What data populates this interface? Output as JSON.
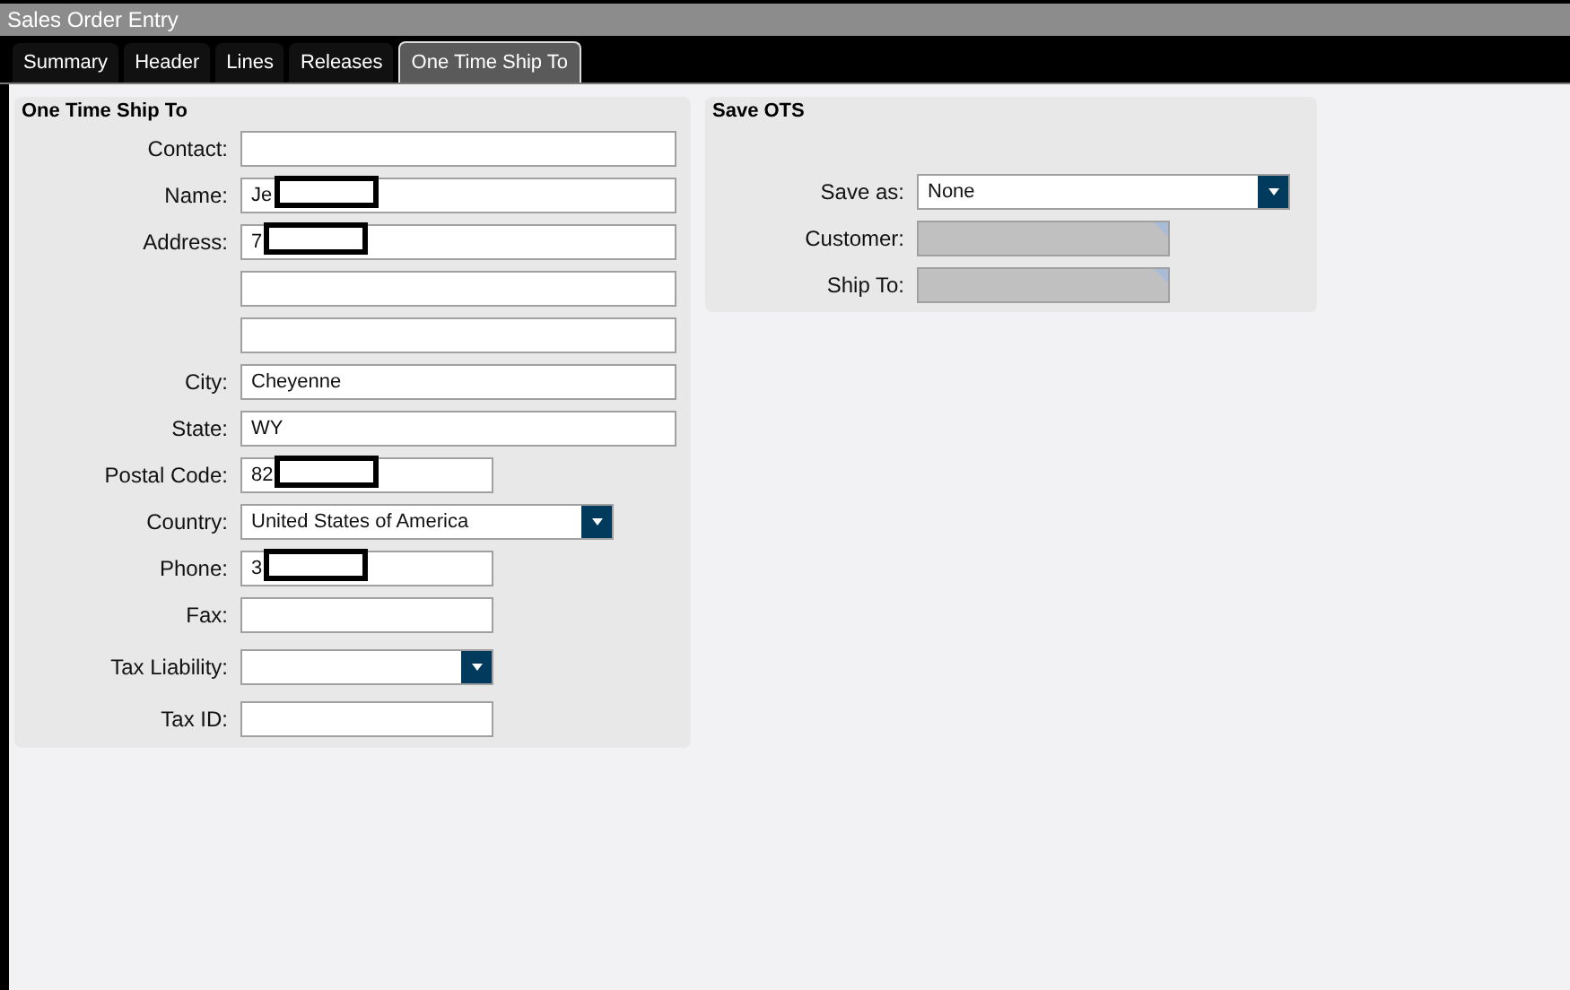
{
  "window": {
    "title": "Sales Order Entry"
  },
  "tabs": [
    {
      "label": "Summary",
      "selected": false
    },
    {
      "label": "Header",
      "selected": false
    },
    {
      "label": "Lines",
      "selected": false
    },
    {
      "label": "Releases",
      "selected": false
    },
    {
      "label": "One Time Ship To",
      "selected": true
    }
  ],
  "ship_to": {
    "title": "One Time Ship To",
    "fields": [
      {
        "label": "Contact:",
        "kind": "text"
      },
      {
        "label": "Name:",
        "kind": "text",
        "value": "Je",
        "redacted": true
      },
      {
        "label": "Address:",
        "kind": "text",
        "value": "7",
        "redacted": true
      },
      {
        "kind": "text"
      },
      {
        "kind": "text"
      },
      {
        "label": "City:",
        "kind": "text",
        "value": "Cheyenne"
      },
      {
        "label": "State:",
        "kind": "text",
        "value": "WY"
      },
      {
        "label": "Postal Code:",
        "kind": "short",
        "value": "82",
        "redacted": true
      },
      {
        "label": "Country:",
        "kind": "select",
        "value": "United States of America"
      },
      {
        "label": "Phone:",
        "kind": "short",
        "value": "3",
        "redacted": true
      },
      {
        "label": "Fax:",
        "kind": "short"
      },
      {
        "label": "Tax Liability:",
        "kind": "short-select"
      },
      {
        "label": "Tax ID:",
        "kind": "short"
      }
    ]
  },
  "save_ots": {
    "title": "Save OTS",
    "fields": [
      {
        "label": "Save as:",
        "kind": "select",
        "value": "None"
      },
      {
        "label": "Customer:",
        "kind": "readonly"
      },
      {
        "label": "Ship To:",
        "kind": "readonly"
      }
    ]
  }
}
